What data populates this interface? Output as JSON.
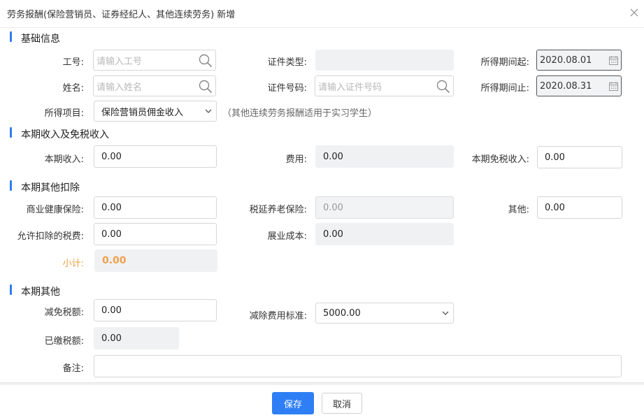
{
  "dialog": {
    "title": "劳务报酬(保险营销员、证券经纪人、其他连续劳务) 新增"
  },
  "sections": {
    "basic": "基础信息",
    "income": "本期收入及免税收入",
    "deduction": "本期其他扣除",
    "other": "本期其他"
  },
  "basic": {
    "emp_no_label": "工号:",
    "emp_no_placeholder": "请输入工号",
    "name_label": "姓名:",
    "name_placeholder": "请输入姓名",
    "id_type_label": "证件类型:",
    "id_type_value": "",
    "id_no_label": "证件号码:",
    "id_no_placeholder": "请输入证件号码",
    "period_start_label": "所得期间起:",
    "period_start_value": "2020.08.01",
    "period_end_label": "所得期间止:",
    "period_end_value": "2020.08.31",
    "item_label": "所得项目:",
    "item_value": "保险营销员佣金收入",
    "item_note": "（其他连续劳务报酬适用于实习学生）"
  },
  "income": {
    "income_label": "本期收入:",
    "income_value": "0.00",
    "cost_label": "费用:",
    "cost_value": "0.00",
    "exempt_label": "本期免税收入:",
    "exempt_value": "0.00"
  },
  "deduction": {
    "health_label": "商业健康保险:",
    "health_value": "0.00",
    "pension_label": "税延养老保险:",
    "pension_value": "0.00",
    "other_label": "其他:",
    "other_value": "0.00",
    "allowed_tax_label": "允许扣除的税费:",
    "allowed_tax_value": "0.00",
    "biz_cost_label": "展业成本:",
    "biz_cost_value": "0.00",
    "subtotal_label": "小计:",
    "subtotal_value": "0.00"
  },
  "other": {
    "relief_label": "减免税额:",
    "relief_value": "0.00",
    "standard_label": "减除费用标准:",
    "standard_value": "5000.00",
    "paid_label": "已缴税额:",
    "paid_value": "0.00",
    "remark_label": "备注:",
    "remark_value": ""
  },
  "footer": {
    "save_label": "保存",
    "cancel_label": "取消"
  },
  "colors": {
    "accent": "#2e7ff5",
    "subtotal": "#e7a23c"
  }
}
